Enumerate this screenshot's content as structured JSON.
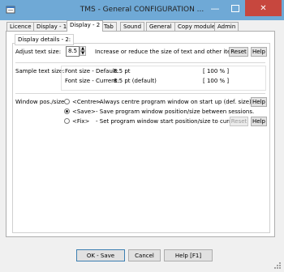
{
  "window": {
    "title": "TMS - General CONFIGURATION ..."
  },
  "tabs": [
    "Licence",
    "Display - 1",
    "Display - 2",
    "Tab",
    "Sound",
    "General",
    "Copy module",
    "Admin"
  ],
  "group_title": "Display details - 2:",
  "adjust": {
    "label": "Adjust text size:",
    "value": "8.5",
    "description": "Increase or reduce the size of text and other items.",
    "reset_label": "Reset",
    "help_label": "Help"
  },
  "sample": {
    "label": "Sample text size:",
    "default_label": "Font size - Default:",
    "default_value": "8.5 pt",
    "default_pct": "[ 100 % ]",
    "current_label": "Font size - Current:",
    "current_value": "8.5 pt (default)",
    "current_pct": "[ 100 % ]"
  },
  "window_pos": {
    "label": "Window pos./size:",
    "options": [
      {
        "label": "<Centre>",
        "description": "- Always centre program window on start up (def. size).",
        "selected": false
      },
      {
        "label": "<Save>",
        "description": "- Save program window position/size between sessions.",
        "selected": true
      },
      {
        "label": "<Fix>",
        "description": "- Set program window start position/size to current",
        "selected": false
      }
    ],
    "help_label": "Help",
    "reset_label": "Reset",
    "help2_label": "Help"
  },
  "footer": {
    "ok_label": "OK - Save",
    "cancel_label": "Cancel",
    "help_label": "Help [F1]"
  },
  "colors": {
    "titlebar": "#6fa9d6",
    "close": "#c7473e"
  }
}
